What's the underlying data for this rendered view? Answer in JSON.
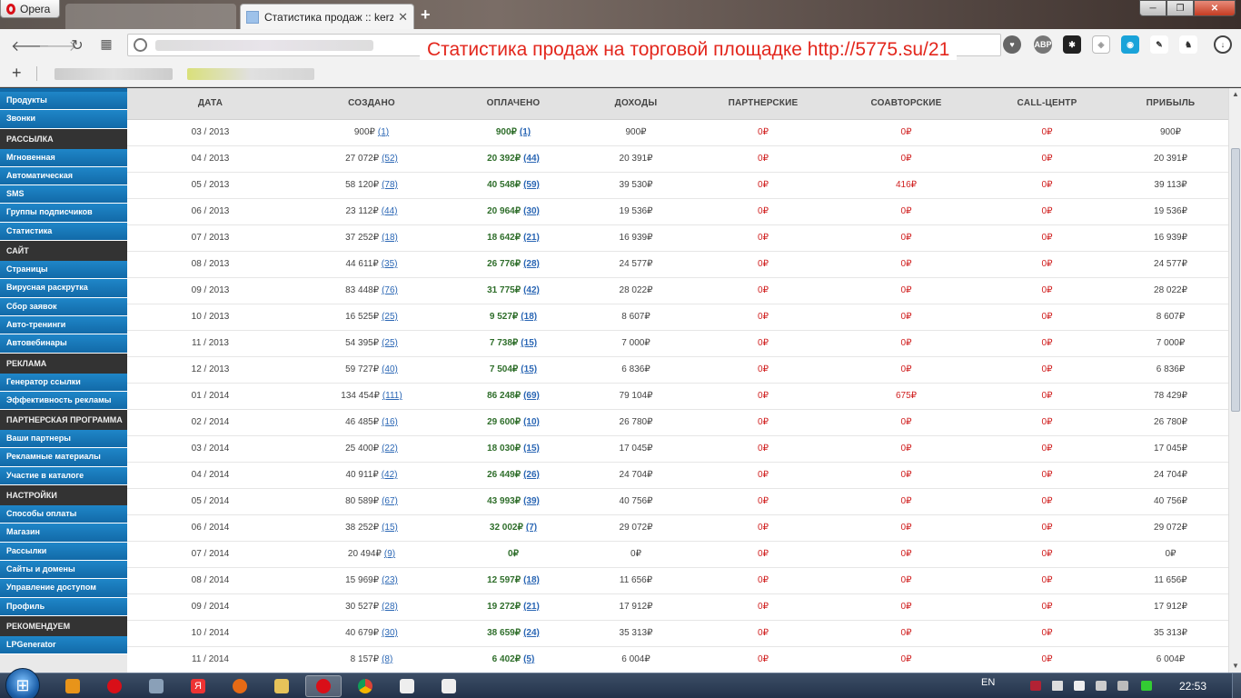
{
  "browser": {
    "menu_label": "Opera",
    "active_tab_title": "Статистика продаж :: kerz",
    "new_tab_symbol": "+",
    "window_controls": {
      "minimize": "─",
      "maximize": "❐",
      "close": "✕"
    }
  },
  "overlay_caption": "Статистика продаж на торговой площадке http://5775.su/21",
  "bookmarks": {
    "add_symbol": "+"
  },
  "sidebar": {
    "sections": [
      {
        "type": "item",
        "label": "Продукты"
      },
      {
        "type": "item",
        "label": "Звонки"
      },
      {
        "type": "head",
        "label": "РАССЫЛКА"
      },
      {
        "type": "item",
        "label": "Мгновенная"
      },
      {
        "type": "item",
        "label": "Автоматическая"
      },
      {
        "type": "item",
        "label": "SMS"
      },
      {
        "type": "item",
        "label": "Группы подписчиков"
      },
      {
        "type": "item",
        "label": "Статистика"
      },
      {
        "type": "head",
        "label": "САЙТ"
      },
      {
        "type": "item",
        "label": "Страницы"
      },
      {
        "type": "item",
        "label": "Вирусная раскрутка"
      },
      {
        "type": "item",
        "label": "Сбор заявок"
      },
      {
        "type": "item",
        "label": "Авто-тренинги"
      },
      {
        "type": "item",
        "label": "Автовебинары"
      },
      {
        "type": "head",
        "label": "РЕКЛАМА"
      },
      {
        "type": "item",
        "label": "Генератор ссылки"
      },
      {
        "type": "item",
        "label": "Эффективность рекламы"
      },
      {
        "type": "head",
        "label": "ПАРТНЕРСКАЯ ПРОГРАММА"
      },
      {
        "type": "item",
        "label": "Ваши партнеры"
      },
      {
        "type": "item",
        "label": "Рекламные материалы"
      },
      {
        "type": "item",
        "label": "Участие в каталоге"
      },
      {
        "type": "head",
        "label": "НАСТРОЙКИ"
      },
      {
        "type": "item",
        "label": "Способы оплаты"
      },
      {
        "type": "item",
        "label": "Магазин"
      },
      {
        "type": "item",
        "label": "Рассылки"
      },
      {
        "type": "item",
        "label": "Сайты и домены"
      },
      {
        "type": "item",
        "label": "Управление доступом"
      },
      {
        "type": "item",
        "label": "Профиль"
      },
      {
        "type": "head",
        "label": "РЕКОМЕНДУЕМ"
      },
      {
        "type": "item",
        "label": "LPGenerator"
      }
    ]
  },
  "table": {
    "currency": "₽",
    "columns": [
      "ДАТА",
      "СОЗДАНО",
      "ОПЛАЧЕНО",
      "ДОХОДЫ",
      "ПАРТНЕРСКИЕ",
      "СОАВТОРСКИЕ",
      "CALL-ЦЕНТР",
      "ПРИБЫЛЬ"
    ],
    "rows": [
      {
        "date": "03 / 2013",
        "created": "900",
        "created_count": "(1)",
        "paid": "900",
        "paid_count": "(1)",
        "income": "900",
        "partner": "0",
        "coauthor": "0",
        "callcenter": "0",
        "profit": "900"
      },
      {
        "date": "04 / 2013",
        "created": "27 072",
        "created_count": "(52)",
        "paid": "20 392",
        "paid_count": "(44)",
        "income": "20 391",
        "partner": "0",
        "coauthor": "0",
        "callcenter": "0",
        "profit": "20 391"
      },
      {
        "date": "05 / 2013",
        "created": "58 120",
        "created_count": "(78)",
        "paid": "40 548",
        "paid_count": "(59)",
        "income": "39 530",
        "partner": "0",
        "coauthor": "416",
        "callcenter": "0",
        "profit": "39 113"
      },
      {
        "date": "06 / 2013",
        "created": "23 112",
        "created_count": "(44)",
        "paid": "20 964",
        "paid_count": "(30)",
        "income": "19 536",
        "partner": "0",
        "coauthor": "0",
        "callcenter": "0",
        "profit": "19 536"
      },
      {
        "date": "07 / 2013",
        "created": "37 252",
        "created_count": "(18)",
        "paid": "18 642",
        "paid_count": "(21)",
        "income": "16 939",
        "partner": "0",
        "coauthor": "0",
        "callcenter": "0",
        "profit": "16 939"
      },
      {
        "date": "08 / 2013",
        "created": "44 611",
        "created_count": "(35)",
        "paid": "26 776",
        "paid_count": "(28)",
        "income": "24 577",
        "partner": "0",
        "coauthor": "0",
        "callcenter": "0",
        "profit": "24 577"
      },
      {
        "date": "09 / 2013",
        "created": "83 448",
        "created_count": "(76)",
        "paid": "31 775",
        "paid_count": "(42)",
        "income": "28 022",
        "partner": "0",
        "coauthor": "0",
        "callcenter": "0",
        "profit": "28 022"
      },
      {
        "date": "10 / 2013",
        "created": "16 525",
        "created_count": "(25)",
        "paid": "9 527",
        "paid_count": "(18)",
        "income": "8 607",
        "partner": "0",
        "coauthor": "0",
        "callcenter": "0",
        "profit": "8 607"
      },
      {
        "date": "11 / 2013",
        "created": "54 395",
        "created_count": "(25)",
        "paid": "7 738",
        "paid_count": "(15)",
        "income": "7 000",
        "partner": "0",
        "coauthor": "0",
        "callcenter": "0",
        "profit": "7 000"
      },
      {
        "date": "12 / 2013",
        "created": "59 727",
        "created_count": "(40)",
        "paid": "7 504",
        "paid_count": "(15)",
        "income": "6 836",
        "partner": "0",
        "coauthor": "0",
        "callcenter": "0",
        "profit": "6 836"
      },
      {
        "date": "01 / 2014",
        "created": "134 454",
        "created_count": "(111)",
        "paid": "86 248",
        "paid_count": "(69)",
        "income": "79 104",
        "partner": "0",
        "coauthor": "675",
        "callcenter": "0",
        "profit": "78 429"
      },
      {
        "date": "02 / 2014",
        "created": "46 485",
        "created_count": "(16)",
        "paid": "29 600",
        "paid_count": "(10)",
        "income": "26 780",
        "partner": "0",
        "coauthor": "0",
        "callcenter": "0",
        "profit": "26 780"
      },
      {
        "date": "03 / 2014",
        "created": "25 400",
        "created_count": "(22)",
        "paid": "18 030",
        "paid_count": "(15)",
        "income": "17 045",
        "partner": "0",
        "coauthor": "0",
        "callcenter": "0",
        "profit": "17 045"
      },
      {
        "date": "04 / 2014",
        "created": "40 911",
        "created_count": "(42)",
        "paid": "26 449",
        "paid_count": "(26)",
        "income": "24 704",
        "partner": "0",
        "coauthor": "0",
        "callcenter": "0",
        "profit": "24 704"
      },
      {
        "date": "05 / 2014",
        "created": "80 589",
        "created_count": "(67)",
        "paid": "43 993",
        "paid_count": "(39)",
        "income": "40 756",
        "partner": "0",
        "coauthor": "0",
        "callcenter": "0",
        "profit": "40 756"
      },
      {
        "date": "06 / 2014",
        "created": "38 252",
        "created_count": "(15)",
        "paid": "32 002",
        "paid_count": "(7)",
        "income": "29 072",
        "partner": "0",
        "coauthor": "0",
        "callcenter": "0",
        "profit": "29 072"
      },
      {
        "date": "07 / 2014",
        "created": "20 494",
        "created_count": "(9)",
        "paid": "0",
        "paid_count": "",
        "income": "0",
        "partner": "0",
        "coauthor": "0",
        "callcenter": "0",
        "profit": "0"
      },
      {
        "date": "08 / 2014",
        "created": "15 969",
        "created_count": "(23)",
        "paid": "12 597",
        "paid_count": "(18)",
        "income": "11 656",
        "partner": "0",
        "coauthor": "0",
        "callcenter": "0",
        "profit": "11 656"
      },
      {
        "date": "09 / 2014",
        "created": "30 527",
        "created_count": "(28)",
        "paid": "19 272",
        "paid_count": "(21)",
        "income": "17 912",
        "partner": "0",
        "coauthor": "0",
        "callcenter": "0",
        "profit": "17 912"
      },
      {
        "date": "10 / 2014",
        "created": "40 679",
        "created_count": "(30)",
        "paid": "38 659",
        "paid_count": "(24)",
        "income": "35 313",
        "partner": "0",
        "coauthor": "0",
        "callcenter": "0",
        "profit": "35 313"
      },
      {
        "date": "11 / 2014",
        "created": "8 157",
        "created_count": "(8)",
        "paid": "6 402",
        "paid_count": "(5)",
        "income": "6 004",
        "partner": "0",
        "coauthor": "0",
        "callcenter": "0",
        "profit": "6 004"
      }
    ]
  },
  "taskbar": {
    "language": "EN",
    "clock": "22:53"
  },
  "colors": {
    "sidebar_item": "#1a78bb",
    "sidebar_head": "#333333",
    "paid_green": "#2f6e2b",
    "zero_red": "#d01f1f",
    "link_blue": "#2a66b4",
    "caption_red": "#e3261c"
  }
}
